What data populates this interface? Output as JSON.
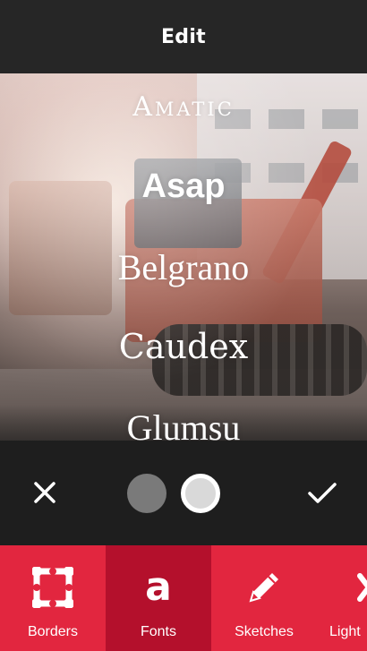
{
  "header": {
    "title": "Edit"
  },
  "fonts": {
    "options": [
      "Amatic",
      "Asap",
      "Belgrano",
      "Caudex",
      "Glumsu"
    ],
    "selected": "Asap"
  },
  "controls": {
    "cancel_icon": "close-icon",
    "confirm_icon": "check-icon",
    "color_swatches": [
      {
        "name": "gray",
        "color": "#7a7a7a"
      },
      {
        "name": "white",
        "color": "#ffffff",
        "selected": true
      }
    ]
  },
  "tabs": [
    {
      "label": "Borders",
      "icon": "border-frame-icon",
      "active": false
    },
    {
      "label": "Fonts",
      "icon": "font-a-icon",
      "active": true
    },
    {
      "label": "Sketches",
      "icon": "pencil-icon",
      "active": false
    },
    {
      "label": "Light",
      "icon": "light-icon",
      "active": false
    }
  ],
  "colors": {
    "accent": "#e2263f",
    "accent_active": "#b4102c",
    "background": "#1e1e1e"
  }
}
